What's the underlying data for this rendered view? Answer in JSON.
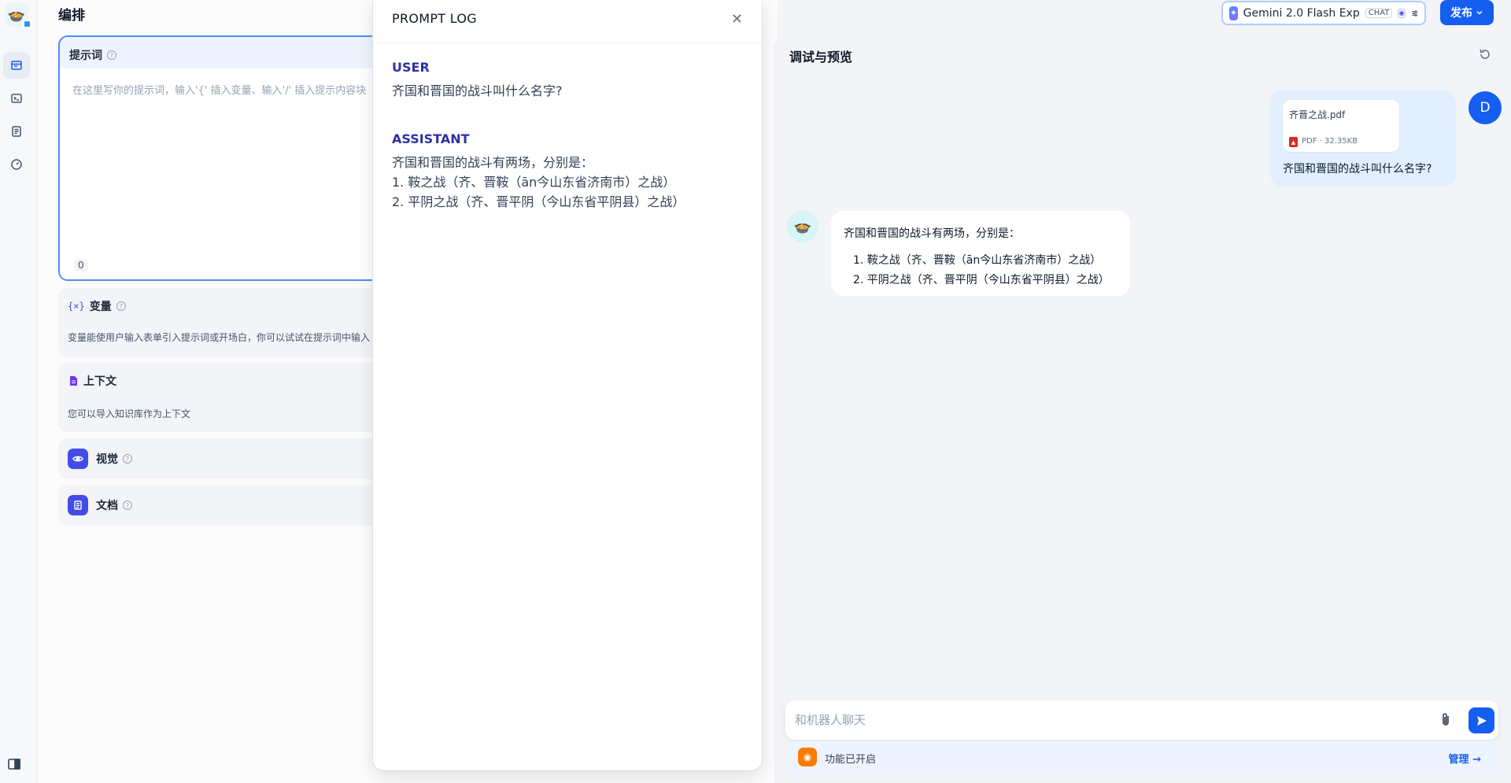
{
  "header": {
    "page_title": "编排",
    "model_name": "Gemini 2.0 Flash Exp",
    "model_tag": "CHAT",
    "publish_label": "发布"
  },
  "prompt": {
    "title": "提示词",
    "placeholder": "在这里写你的提示词，输入'{' 插入变量、输入'/' 插入提示内容块",
    "char_count": "0"
  },
  "variables": {
    "title": "变量",
    "description": "变量能使用户输入表单引入提示词或开场白，你可以试试在提示词中输入"
  },
  "context": {
    "title": "上下文",
    "description": "您可以导入知识库作为上下文"
  },
  "vision": {
    "title": "视觉"
  },
  "document": {
    "title": "文档"
  },
  "prompt_log": {
    "header": "PROMPT LOG",
    "user_role": "USER",
    "user_text": "齐国和晋国的战斗叫什么名字?",
    "assistant_role": "ASSISTANT",
    "assistant_lines": [
      "齐国和晋国的战斗有两场，分别是：",
      "1. 鞍之战（齐、晋鞍（ān今山东省济南市）之战）",
      "2. 平阴之战（齐、晋平阴（今山东省平阴县）之战）"
    ]
  },
  "preview": {
    "title": "调试与预览",
    "user_avatar": "D",
    "file_name": "齐晋之战.pdf",
    "file_meta": "PDF · 32.35KB",
    "user_message": "齐国和晋国的战斗叫什么名字?",
    "bot_intro": "齐国和晋国的战斗有两场，分别是：",
    "bot_items": [
      "1. 鞍之战（齐、晋鞍（ān今山东省济南市）之战）",
      "2. 平阴之战（齐、晋平阴（今山东省平阴县）之战）"
    ],
    "input_placeholder": "和机器人聊天",
    "feature_status": "功能已开启",
    "manage_label": "管理"
  },
  "colors": {
    "primary": "#155eef",
    "role": "#2d31a6",
    "feature_icon": "#444ce7",
    "feature_bar_icon": "#fb7b00"
  },
  "icons": {
    "app_logo": "robot-pot-icon",
    "nav": [
      "orchestrate-icon",
      "terminal-icon",
      "logs-icon",
      "monitor-icon"
    ],
    "sidebar_toggle": "panel-icon"
  }
}
